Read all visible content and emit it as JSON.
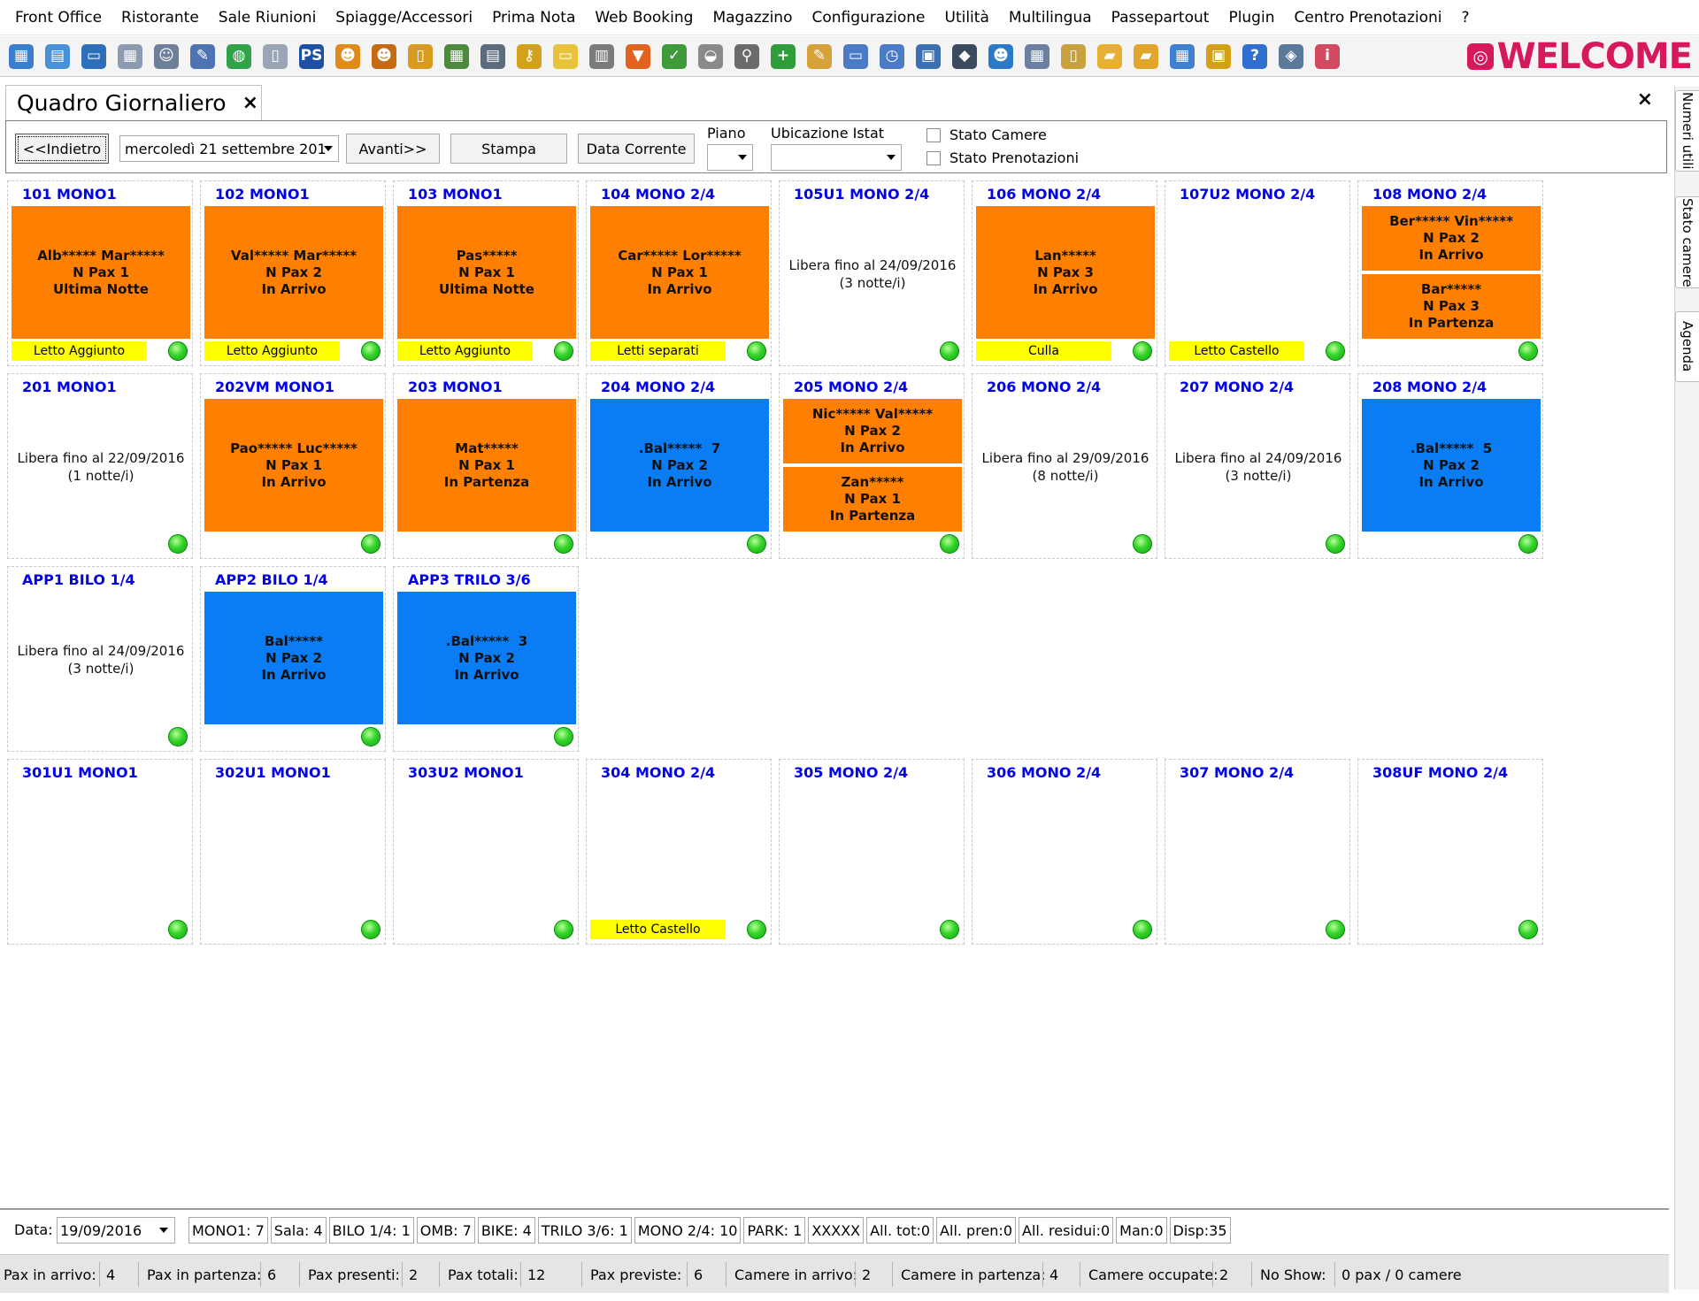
{
  "menu": [
    "Front Office",
    "Ristorante",
    "Sale Riunioni",
    "Spiagge/Accessori",
    "Prima Nota",
    "Web Booking",
    "Magazzino",
    "Configurazione",
    "Utilità",
    "Multilingua",
    "Passepartout",
    "Plugin",
    "Centro Prenotazioni",
    "?"
  ],
  "toolbar_icons": [
    {
      "name": "planning-icon",
      "glyph": "▦",
      "color": "#3b7fd0"
    },
    {
      "name": "calendar-grid-icon",
      "glyph": "▤",
      "color": "#4a90d9"
    },
    {
      "name": "window-icon",
      "glyph": "▭",
      "color": "#2d6fb8"
    },
    {
      "name": "table-icon",
      "glyph": "▦",
      "color": "#8b9bb0"
    },
    {
      "name": "guest-card-icon",
      "glyph": "☺",
      "color": "#6d7f99"
    },
    {
      "name": "edit-form-icon",
      "glyph": "✎",
      "color": "#4d74b0"
    },
    {
      "name": "globe-icon",
      "glyph": "◍",
      "color": "#2fa24a"
    },
    {
      "name": "document-icon",
      "glyph": "▯",
      "color": "#9aa6b5"
    },
    {
      "name": "ps-icon",
      "glyph": "PS",
      "color": "#1d4fa3"
    },
    {
      "name": "user-icon",
      "glyph": "☻",
      "color": "#e08a1c"
    },
    {
      "name": "users-icon",
      "glyph": "☻",
      "color": "#c66b12"
    },
    {
      "name": "document-lock-icon",
      "glyph": "▯",
      "color": "#d89b1f"
    },
    {
      "name": "calendar-icon",
      "glyph": "▦",
      "color": "#4d8a3f"
    },
    {
      "name": "printer-stack-icon",
      "glyph": "▤",
      "color": "#5d6b7e"
    },
    {
      "name": "keys-icon",
      "glyph": "⚷",
      "color": "#d1a21c"
    },
    {
      "name": "notes-icon",
      "glyph": "▭",
      "color": "#e8c23a"
    },
    {
      "name": "printer-icon",
      "glyph": "▥",
      "color": "#7a7a7a"
    },
    {
      "name": "bucket-icon",
      "glyph": "▼",
      "color": "#e2621f"
    },
    {
      "name": "checklist-icon",
      "glyph": "✓",
      "color": "#3f9b3a"
    },
    {
      "name": "cup-icon",
      "glyph": "◒",
      "color": "#8a8a8a"
    },
    {
      "name": "restaurant-icon",
      "glyph": "⚲",
      "color": "#6b6b6b"
    },
    {
      "name": "add-icon",
      "glyph": "+",
      "color": "#2f9e3a"
    },
    {
      "name": "pencil-icon",
      "glyph": "✎",
      "color": "#d8a23a"
    },
    {
      "name": "window-split-icon",
      "glyph": "▭",
      "color": "#4a7bc4"
    },
    {
      "name": "clock-icon",
      "glyph": "◷",
      "color": "#4a7bc4"
    },
    {
      "name": "monitor-icon",
      "glyph": "▣",
      "color": "#3a6fb0"
    },
    {
      "name": "car-icon",
      "glyph": "◆",
      "color": "#3b4a5e"
    },
    {
      "name": "user-search-icon",
      "glyph": "☻",
      "color": "#2b7ac8"
    },
    {
      "name": "calendar-13-icon",
      "glyph": "▦",
      "color": "#6b7fa0"
    },
    {
      "name": "copy-icon",
      "glyph": "▯",
      "color": "#c9a040"
    },
    {
      "name": "folder-icon",
      "glyph": "▰",
      "color": "#e8b033"
    },
    {
      "name": "book-icon",
      "glyph": "▰",
      "color": "#e0a52a"
    },
    {
      "name": "calculator-icon",
      "glyph": "▦",
      "color": "#3f7fcf"
    },
    {
      "name": "lock-icon",
      "glyph": "▣",
      "color": "#d4a017"
    },
    {
      "name": "help-icon",
      "glyph": "?",
      "color": "#2f6fd0"
    },
    {
      "name": "network-icon",
      "glyph": "◈",
      "color": "#5b7a9a"
    },
    {
      "name": "info-icon",
      "glyph": "i",
      "color": "#d24a5f"
    }
  ],
  "logo": {
    "mark": "◎",
    "text": "WELCOME",
    "color": "#d6195d"
  },
  "tab": {
    "title": "Quadro Giornaliero",
    "close": "×"
  },
  "window_close": "×",
  "side_tabs": [
    "Numeri utili",
    "Stato camere",
    "Agenda"
  ],
  "controls": {
    "back_label": "<<Indietro",
    "date_value": "mercoledì 21 settembre 201",
    "forward_label": "Avanti>>",
    "print_label": "Stampa",
    "current_date_label": "Data Corrente",
    "floor_label": "Piano",
    "floor_value": "",
    "istat_label": "Ubicazione Istat",
    "istat_value": "",
    "room_status_label": "Stato Camere",
    "booking_status_label": "Stato Prenotazioni"
  },
  "rooms": [
    {
      "title": "101 MONO1",
      "blocks": [
        {
          "color": "orange",
          "lines": [
            "Alb***** Mar*****",
            "N Pax 1",
            "Ultima Notte"
          ]
        }
      ],
      "free": [],
      "note": "Letto Aggiunto"
    },
    {
      "title": "102 MONO1",
      "blocks": [
        {
          "color": "orange",
          "lines": [
            "Val***** Mar*****",
            "N Pax 2",
            "In Arrivo"
          ]
        }
      ],
      "free": [],
      "note": "Letto Aggiunto"
    },
    {
      "title": "103 MONO1",
      "blocks": [
        {
          "color": "orange",
          "lines": [
            "Pas*****",
            "N Pax 1",
            "Ultima Notte"
          ]
        }
      ],
      "free": [],
      "note": "Letto Aggiunto"
    },
    {
      "title": "104 MONO 2/4",
      "blocks": [
        {
          "color": "orange",
          "lines": [
            "Car***** Lor*****",
            "N Pax 1",
            "In Arrivo"
          ]
        }
      ],
      "free": [],
      "note": "Letti separati"
    },
    {
      "title": "105U1 MONO 2/4",
      "blocks": [],
      "free": [
        "Libera fino al 24/09/2016",
        "(3 notte/i)"
      ],
      "note": ""
    },
    {
      "title": "106 MONO 2/4",
      "blocks": [
        {
          "color": "orange",
          "lines": [
            "Lan*****",
            "N Pax 3",
            "In Arrivo"
          ]
        }
      ],
      "free": [],
      "note": "Culla"
    },
    {
      "title": "107U2 MONO 2/4",
      "blocks": [],
      "free": [],
      "note": "Letto Castello"
    },
    {
      "title": "108 MONO 2/4",
      "blocks": [
        {
          "color": "orange",
          "lines": [
            "Ber***** Vin*****",
            "N Pax 2",
            "In Arrivo"
          ]
        },
        {
          "color": "orange",
          "lines": [
            "Bar*****",
            "N Pax 3",
            "In Partenza"
          ]
        }
      ],
      "free": [],
      "note": ""
    },
    {
      "title": "201 MONO1",
      "blocks": [],
      "free": [
        "Libera fino al 22/09/2016",
        "(1 notte/i)"
      ],
      "note": ""
    },
    {
      "title": "202VM MONO1",
      "blocks": [
        {
          "color": "orange",
          "lines": [
            "Pao***** Luc*****",
            "N Pax 1",
            "In Arrivo"
          ]
        }
      ],
      "free": [],
      "note": ""
    },
    {
      "title": "203 MONO1",
      "blocks": [
        {
          "color": "orange",
          "lines": [
            "Mat*****",
            "N Pax 1",
            "In Partenza"
          ]
        }
      ],
      "free": [],
      "note": ""
    },
    {
      "title": "204 MONO 2/4",
      "blocks": [
        {
          "color": "blue",
          "lines": [
            ".Bal*****  7",
            "N Pax 2",
            "In Arrivo"
          ]
        }
      ],
      "free": [],
      "note": ""
    },
    {
      "title": "205 MONO 2/4",
      "blocks": [
        {
          "color": "orange",
          "lines": [
            "Nic***** Val*****",
            "N Pax 2",
            "In Arrivo"
          ]
        },
        {
          "color": "orange",
          "lines": [
            "Zan*****",
            "N Pax 1",
            "In Partenza"
          ]
        }
      ],
      "free": [],
      "note": ""
    },
    {
      "title": "206 MONO 2/4",
      "blocks": [],
      "free": [
        "Libera fino al 29/09/2016",
        "(8 notte/i)"
      ],
      "note": ""
    },
    {
      "title": "207 MONO 2/4",
      "blocks": [],
      "free": [
        "Libera fino al 24/09/2016",
        "(3 notte/i)"
      ],
      "note": ""
    },
    {
      "title": "208 MONO 2/4",
      "blocks": [
        {
          "color": "blue",
          "lines": [
            ".Bal*****  5",
            "N Pax 2",
            "In Arrivo"
          ]
        }
      ],
      "free": [],
      "note": ""
    },
    {
      "title": "APP1 BILO 1/4",
      "blocks": [],
      "free": [
        "Libera fino al 24/09/2016",
        "(3 notte/i)"
      ],
      "note": ""
    },
    {
      "title": "APP2 BILO 1/4",
      "blocks": [
        {
          "color": "blue",
          "lines": [
            "Bal*****",
            "N Pax 2",
            "In Arrivo"
          ]
        }
      ],
      "free": [],
      "note": ""
    },
    {
      "title": "APP3 TRILO 3/6",
      "blocks": [
        {
          "color": "blue",
          "lines": [
            ".Bal*****  3",
            "N Pax 2",
            "In Arrivo"
          ]
        }
      ],
      "free": [],
      "note": ""
    },
    {
      "title": "301U1 MONO1",
      "blocks": [],
      "free": [],
      "note": ""
    },
    {
      "title": "302U1 MONO1",
      "blocks": [],
      "free": [],
      "note": ""
    },
    {
      "title": "303U2 MONO1",
      "blocks": [],
      "free": [],
      "note": ""
    },
    {
      "title": "304 MONO 2/4",
      "blocks": [],
      "free": [],
      "note": "Letto Castello"
    },
    {
      "title": "305 MONO 2/4",
      "blocks": [],
      "free": [],
      "note": ""
    },
    {
      "title": "306 MONO 2/4",
      "blocks": [],
      "free": [],
      "note": ""
    },
    {
      "title": "307 MONO 2/4",
      "blocks": [],
      "free": [],
      "note": ""
    },
    {
      "title": "308UF MONO 2/4",
      "blocks": [],
      "free": [],
      "note": ""
    }
  ],
  "summary": {
    "date_label": "Data:",
    "date_value": "19/09/2016",
    "cells": [
      "MONO1: 7",
      "Sala: 4",
      "BILO 1/4: 1",
      "OMB: 7",
      "BIKE: 4",
      "TRILO 3/6: 1",
      "MONO 2/4: 10",
      "PARK: 1",
      "XXXXX",
      "All. tot:0",
      "All. pren:0",
      "All. residui:0",
      "Man:0",
      "Disp:35"
    ]
  },
  "statusbar": [
    {
      "label": "Pax in arrivo:",
      "value": "4"
    },
    {
      "label": "Pax in partenza:",
      "value": "6"
    },
    {
      "label": "Pax presenti:",
      "value": "2"
    },
    {
      "label": "Pax totali:",
      "value": "12"
    },
    {
      "label": "Pax previste:",
      "value": "6"
    },
    {
      "label": "Camere in arrivo:",
      "value": "2"
    },
    {
      "label": "Camere in partenza:",
      "value": "4"
    },
    {
      "label": "Camere occupate:",
      "value": "2"
    },
    {
      "label": "No Show:",
      "value": "0 pax / 0 camere"
    }
  ],
  "colors": {
    "orange": "#ff7f00",
    "blue": "#0a7cf4",
    "room_title": "#0000ee",
    "note": "#ffff00",
    "status_ok": "#35d42a"
  }
}
